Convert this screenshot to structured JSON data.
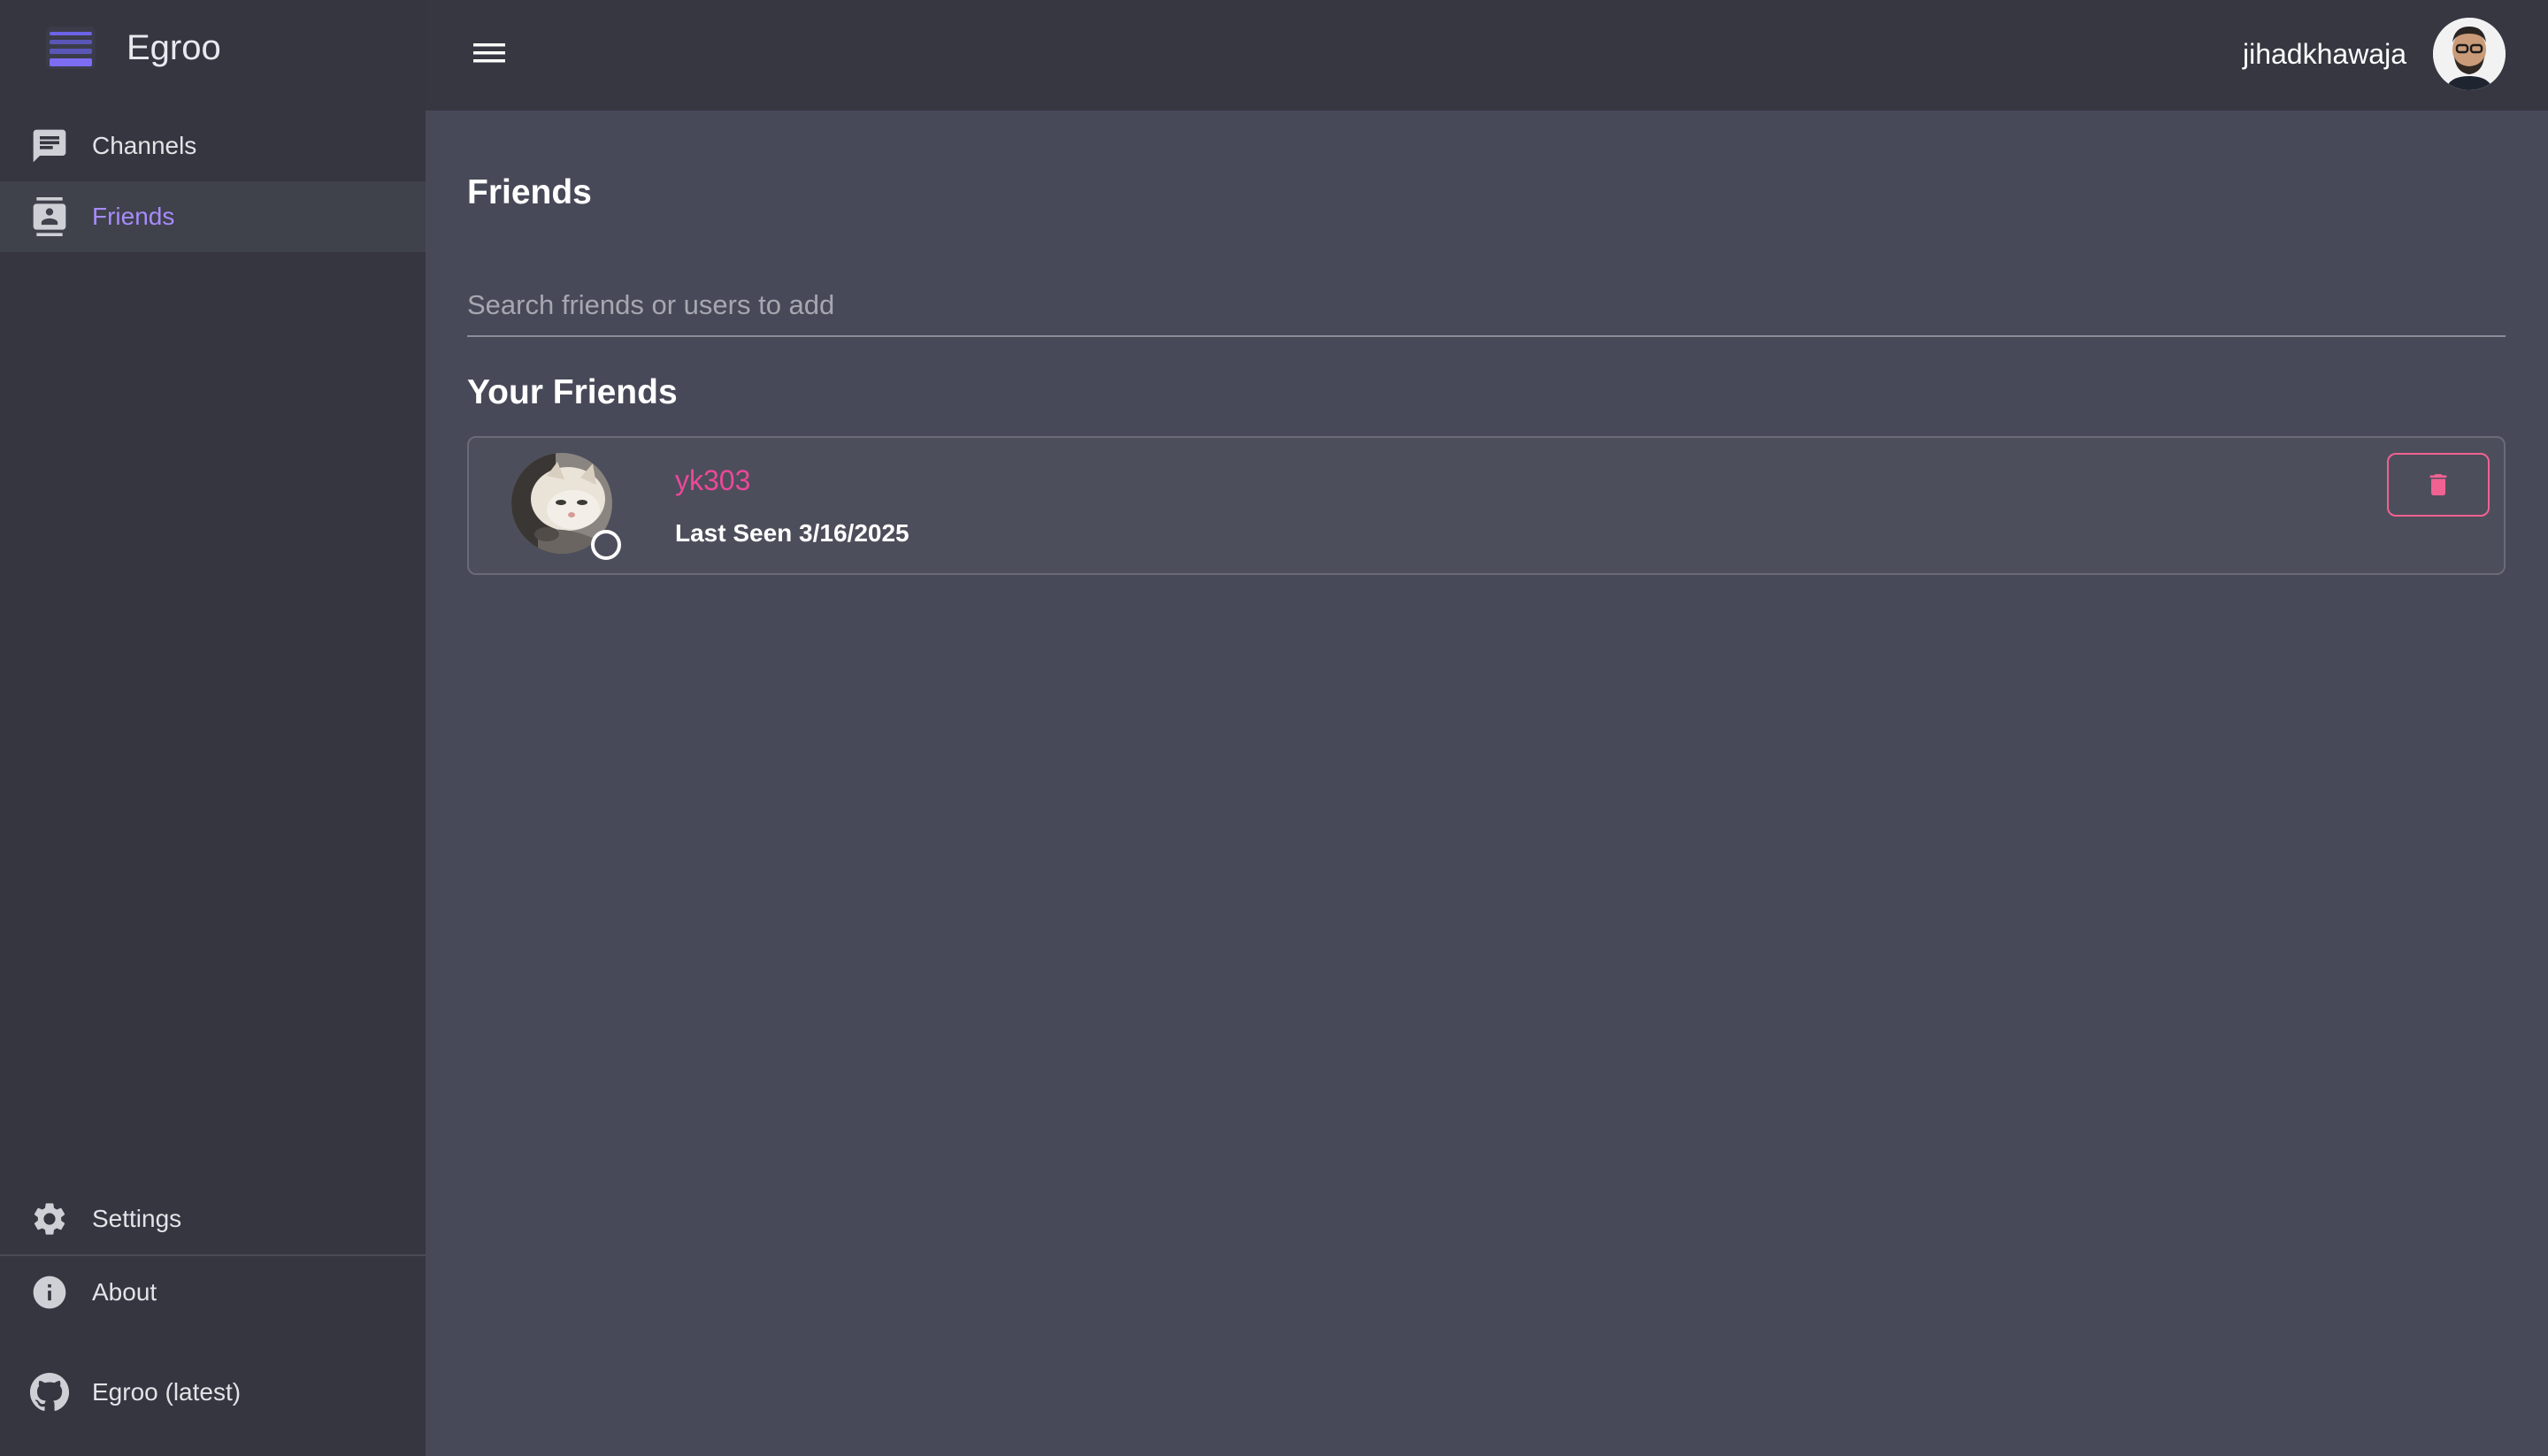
{
  "app": {
    "name": "Egroo",
    "accent": "#a78bfa"
  },
  "sidebar": {
    "items": [
      {
        "label": "Channels",
        "icon": "chat-icon"
      },
      {
        "label": "Friends",
        "icon": "contacts-icon",
        "active": true
      }
    ],
    "bottom_items": [
      {
        "label": "Settings",
        "icon": "gear-icon"
      },
      {
        "label": "About",
        "icon": "info-icon"
      },
      {
        "label": "Egroo (latest)",
        "icon": "github-icon"
      }
    ]
  },
  "header": {
    "menu_icon": "hamburger-icon",
    "username": "jihadkhawaja"
  },
  "main": {
    "title": "Friends",
    "search": {
      "placeholder": "Search friends or users to add",
      "value": ""
    },
    "section_title": "Your Friends",
    "friends": [
      {
        "name": "yk303",
        "last_seen": "Last Seen 3/16/2025",
        "name_color": "#ec4899"
      }
    ]
  }
}
